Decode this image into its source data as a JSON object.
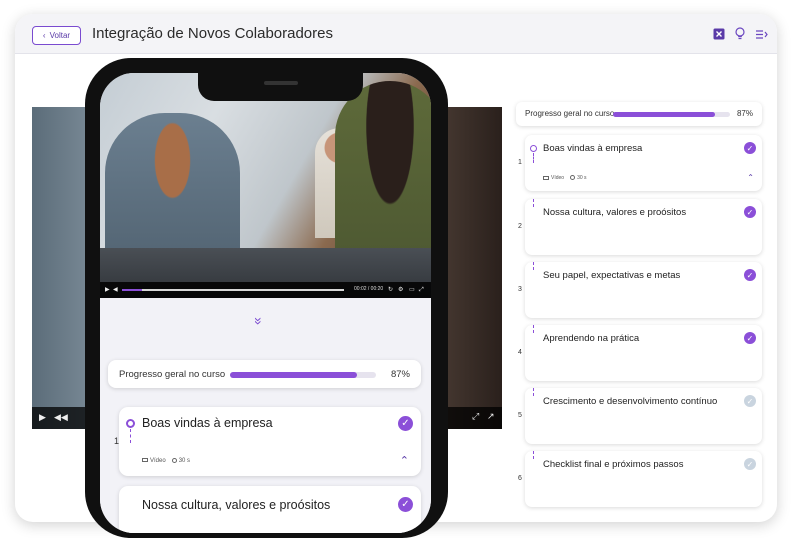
{
  "header": {
    "back_label": "Voltar",
    "title": "Integração de Novos Colaboradores",
    "icons": [
      "close-box-icon",
      "lightbulb-icon",
      "menu-list-icon"
    ]
  },
  "background_player": {
    "icons": [
      "play-icon",
      "rewind-icon",
      "fullscreen-icon",
      "share-icon"
    ]
  },
  "course_progress": {
    "label": "Progresso geral no curso",
    "percent": 87,
    "percent_label": "87%"
  },
  "modules": [
    {
      "number": "1",
      "title": "Boas vindas à empresa",
      "completed": true,
      "expanded": true,
      "meta_type": "Vídeo",
      "meta_duration": "30 s"
    },
    {
      "number": "2",
      "title": "Nossa cultura, valores e proósitos",
      "completed": true
    },
    {
      "number": "3",
      "title": "Seu papel, expectativas e metas",
      "completed": true
    },
    {
      "number": "4",
      "title": "Aprendendo na prática",
      "completed": true
    },
    {
      "number": "5",
      "title": "Crescimento e desenvolvimento contínuo",
      "completed": false
    },
    {
      "number": "6",
      "title": "Checklist final e próximos passos",
      "completed": false
    }
  ],
  "phone": {
    "player": {
      "time": "00:02 / 00:20",
      "progress": 0.09
    },
    "expand_icon": "double-chevron-down-icon"
  },
  "colors": {
    "accent": "#8b4fd8",
    "check_inactive": "#c9d4df",
    "header_bg": "#f4f4f7"
  }
}
